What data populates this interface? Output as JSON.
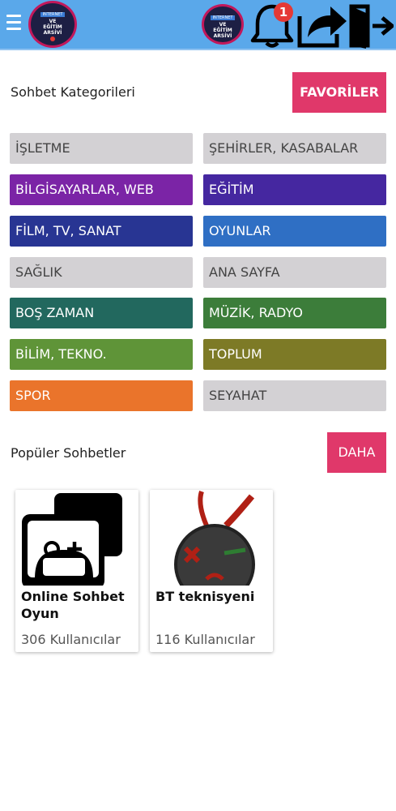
{
  "header": {
    "logo_text": {
      "line1": "INTERNET",
      "line2": "VE",
      "line3": "EĞİTİM",
      "line4": "ARSİVİ"
    },
    "notification_count": "1",
    "icons": [
      "menu-icon",
      "bell-icon",
      "share-icon",
      "exit-icon"
    ]
  },
  "categories_section": {
    "title": "Sohbet Kategorileri",
    "favorites_label": "FAVORİLER",
    "items": [
      {
        "label": "İŞLETME",
        "color": "#d3d1d4"
      },
      {
        "label": "ŞEHİRLER, KASABALAR",
        "color": "#d3d1d4"
      },
      {
        "label": "BİLGİSAYARLAR, WEB",
        "color": "#7b24a6"
      },
      {
        "label": "EĞİTİM",
        "color": "#4527a0"
      },
      {
        "label": "FİLM, TV, SANAT",
        "color": "#283593"
      },
      {
        "label": "OYUNLAR",
        "color": "#2f6fc4"
      },
      {
        "label": "SAĞLIK",
        "color": "#d3d1d4"
      },
      {
        "label": "ANA SAYFA",
        "color": "#d3d1d4"
      },
      {
        "label": "BOŞ ZAMAN",
        "color": "#22685e"
      },
      {
        "label": "MÜZİK, RADYO",
        "color": "#3c7d3a"
      },
      {
        "label": "BİLİM, TEKNO.",
        "color": "#5f9438"
      },
      {
        "label": "TOPLUM",
        "color": "#7d7a26"
      },
      {
        "label": "SPOR",
        "color": "#ea742b"
      },
      {
        "label": "SEYAHAT",
        "color": "#d3d1d4"
      }
    ]
  },
  "popular_section": {
    "title": "Popüler Sohbetler",
    "more_label": "DAHA",
    "cards": [
      {
        "name": "Online Sohbet Oyun",
        "users": "306 Kullanıcılar"
      },
      {
        "name": "BT teknisyeni",
        "users": "116 Kullanıcılar"
      }
    ]
  },
  "colors": {
    "header_bg": "#5aa8ea",
    "accent": "#e0386a"
  }
}
